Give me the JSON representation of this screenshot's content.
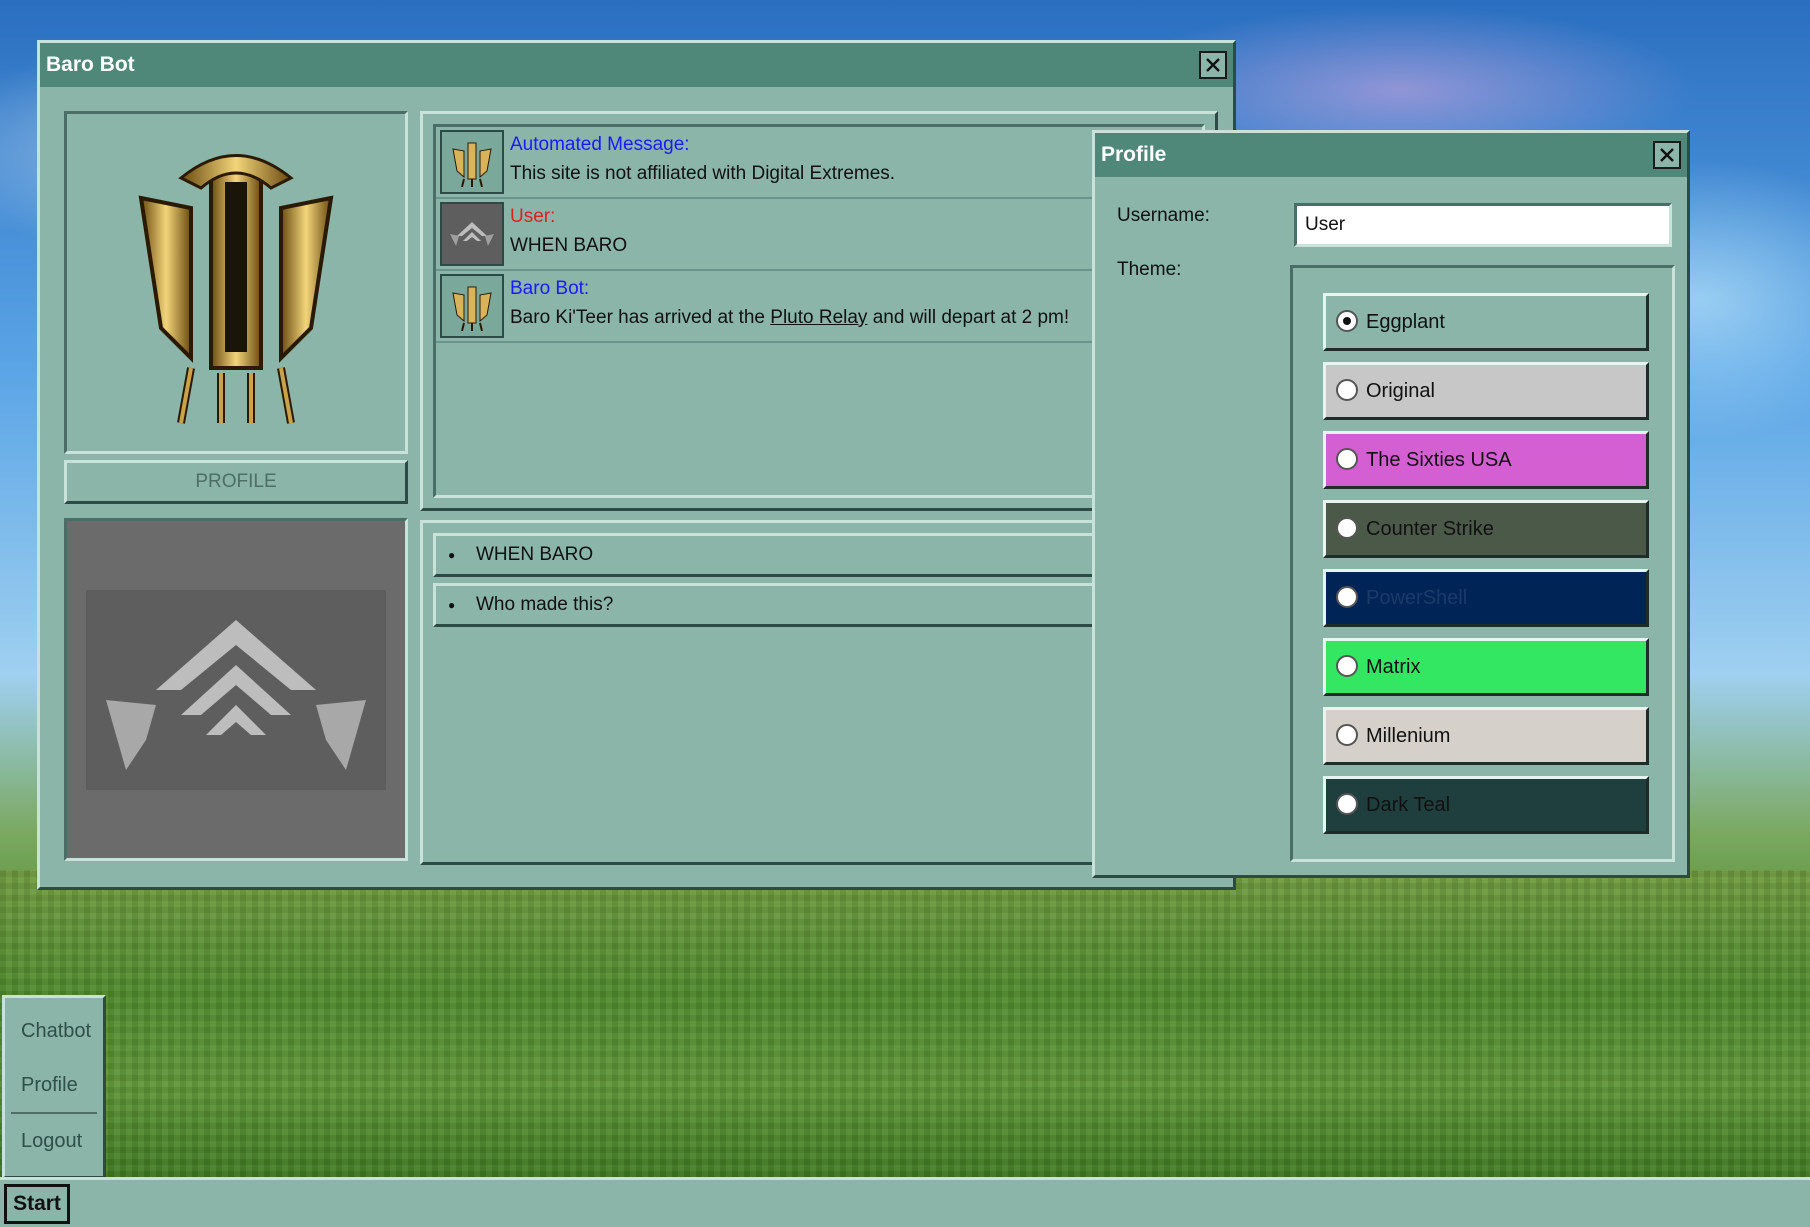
{
  "chat_window": {
    "title": "Baro Bot",
    "profile_button": "PROFILE",
    "messages": [
      {
        "sender": "Automated Message:",
        "text_parts": [
          "This site is not affiliated with Digital Extremes."
        ]
      },
      {
        "sender": "User:",
        "text_parts": [
          "WHEN BARO"
        ]
      },
      {
        "sender": "Baro Bot:",
        "text_before": "Baro Ki'Teer has arrived at the ",
        "link": "Pluto Relay",
        "text_after": " and will depart at 2 pm!"
      }
    ],
    "suggestions": [
      "WHEN BARO",
      "Who made this?"
    ]
  },
  "profile_window": {
    "title": "Profile",
    "username_label": "Username:",
    "username_value": "User",
    "theme_label": "Theme:",
    "themes": [
      {
        "label": "Eggplant",
        "selected": true,
        "bg": "#8ab5a8",
        "fg": "#111111"
      },
      {
        "label": "Original",
        "selected": false,
        "bg": "#c7c7c7",
        "fg": "#111111"
      },
      {
        "label": "The Sixties USA",
        "selected": false,
        "bg": "#d35fd3",
        "fg": "#111111"
      },
      {
        "label": "Counter Strike",
        "selected": false,
        "bg": "#4b5a48",
        "fg": "#111111"
      },
      {
        "label": "PowerShell",
        "selected": false,
        "bg": "#012456",
        "fg": "#1a3a6a"
      },
      {
        "label": "Matrix",
        "selected": false,
        "bg": "#33e763",
        "fg": "#111111"
      },
      {
        "label": "Millenium",
        "selected": false,
        "bg": "#d6d0ca",
        "fg": "#111111"
      },
      {
        "label": "Dark Teal",
        "selected": false,
        "bg": "#1f3f3e",
        "fg": "#111111"
      }
    ]
  },
  "start_menu": {
    "items": [
      "Chatbot",
      "Profile",
      "Logout"
    ]
  },
  "taskbar": {
    "start_label": "Start"
  },
  "colors": {
    "window_bg": "#8ab5a8",
    "titlebar": "#4f8878"
  }
}
